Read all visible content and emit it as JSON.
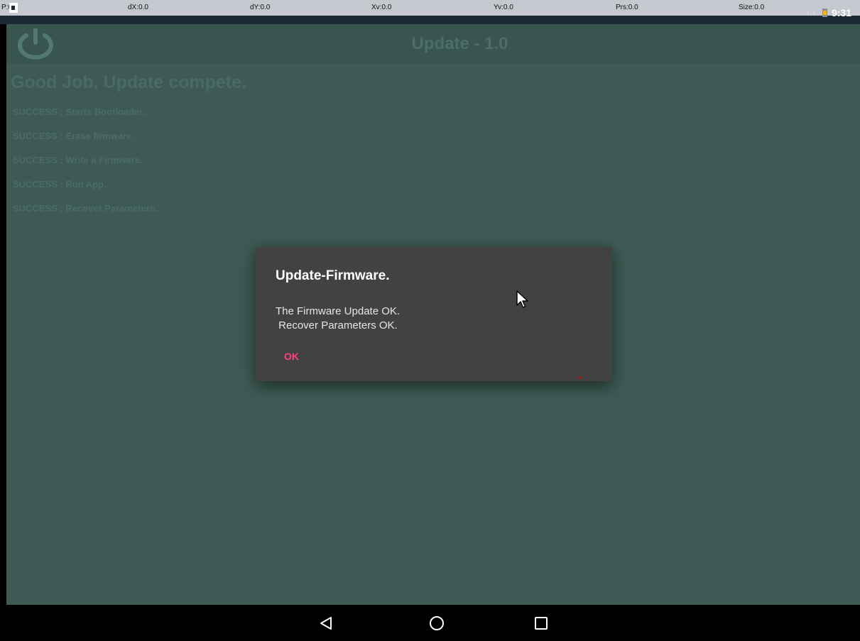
{
  "pointer_bar": {
    "p": "P:0/1",
    "dx": "dX:0.0",
    "dy": "dY:0.0",
    "xv": "Xv:0.0",
    "yv": "Yv:0.0",
    "prs": "Prs:0.0",
    "size": "Size:0.0"
  },
  "status_bar": {
    "time": "9:31",
    "left_icon": "notification-icon",
    "right_icons": [
      "data-transfer-icon",
      "battery-charging-icon"
    ]
  },
  "app": {
    "title": "Update - 1.0",
    "power_icon": "power-icon",
    "headline": "Good Job. Update compete.",
    "log": [
      "SUCCESS : Starts Bootloader.",
      "SUCCESS : Erase firmware.",
      "SUCCESS : Write a Firmware.",
      "SUCCESS : Run App.",
      "SUCCESS : Recover Parameters."
    ]
  },
  "dialog": {
    "title": "Update-Firmware.",
    "message": "The Firmware Update OK.\n Recover Parameters OK.",
    "ok_label": "OK"
  },
  "nav_bar": {
    "icons": [
      "back-icon",
      "home-icon",
      "recent-apps-icon"
    ]
  },
  "colors": {
    "app_background": "#3d5b54",
    "dialog_background": "#424242",
    "accent": "#ff4081",
    "status_bar": "#1d2a33"
  }
}
